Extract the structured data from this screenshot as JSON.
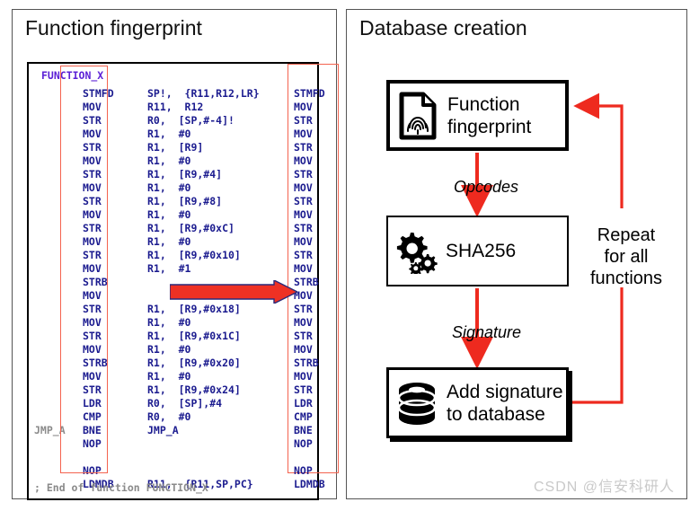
{
  "left_panel": {
    "title": "Function fingerprint",
    "function_label": "FUNCTION_X",
    "end_comment": "; End of function FUNCTION_X",
    "jump_label": "JMP_A",
    "mnemonics": "STMFD\nMOV\nSTR\nMOV\nSTR\nMOV\nSTR\nMOV\nSTR\nMOV\nSTR\nMOV\nSTR\nMOV\nSTRB\nMOV\nSTR\nMOV\nSTR\nMOV\nSTRB\nMOV\nSTR\nLDR\nCMP\nBNE\nNOP\n\nNOP\nLDMDB",
    "operands": "SP!,  {R11,R12,LR}\nR11,  R12\nR0,  [SP,#-4]!\nR1,  #0\nR1,  [R9]\nR1,  #0\nR1,  [R9,#4]\nR1,  #0\nR1,  [R9,#8]\nR1,  #0\nR1,  [R9,#0xC]\nR1,  #0\nR1,  [R9,#0x10]\nR1,  #1\n\n\nR1,  [R9,#0x18]\nR1,  #0\nR1,  [R9,#0x1C]\nR1,  #0\nR1,  [R9,#0x20]\nR1,  #0\nR1,  [R9,#0x24]\nR0,  [SP],#4\nR0,  #0\nJMP_A\n\n\n\nR11,  {R11,SP,PC}",
    "extracted_mnemonics": "STMFD\nMOV\nSTR\nMOV\nSTR\nMOV\nSTR\nMOV\nSTR\nMOV\nSTR\nMOV\nSTR\nMOV\nSTRB\nMOV\nSTR\nMOV\nSTR\nMOV\nSTRB\nMOV\nSTR\nLDR\nCMP\nBNE\nNOP\n\nNOP\nLDMDB",
    "highlight_color": "#f4634f",
    "arrow_color": "#ee3124",
    "mnemonic_color": "#1b1b8f",
    "label_color": "#5b1fd6"
  },
  "right_panel": {
    "title": "Database creation",
    "boxes": [
      {
        "id": "fingerprint",
        "label": "Function\nfingerprint",
        "icon": "document-fingerprint-icon"
      },
      {
        "id": "sha256",
        "label": "SHA256",
        "icon": "gears-icon"
      },
      {
        "id": "database",
        "label": "Add signature\nto database",
        "icon": "database-cylinder-icon"
      }
    ],
    "edge_labels": {
      "opcodes": "Opcodes",
      "signature": "Signature"
    },
    "loop_label": "Repeat\nfor all\nfunctions",
    "flow_color": "#ee2a1f"
  },
  "watermark": "CSDN @信安科研人"
}
